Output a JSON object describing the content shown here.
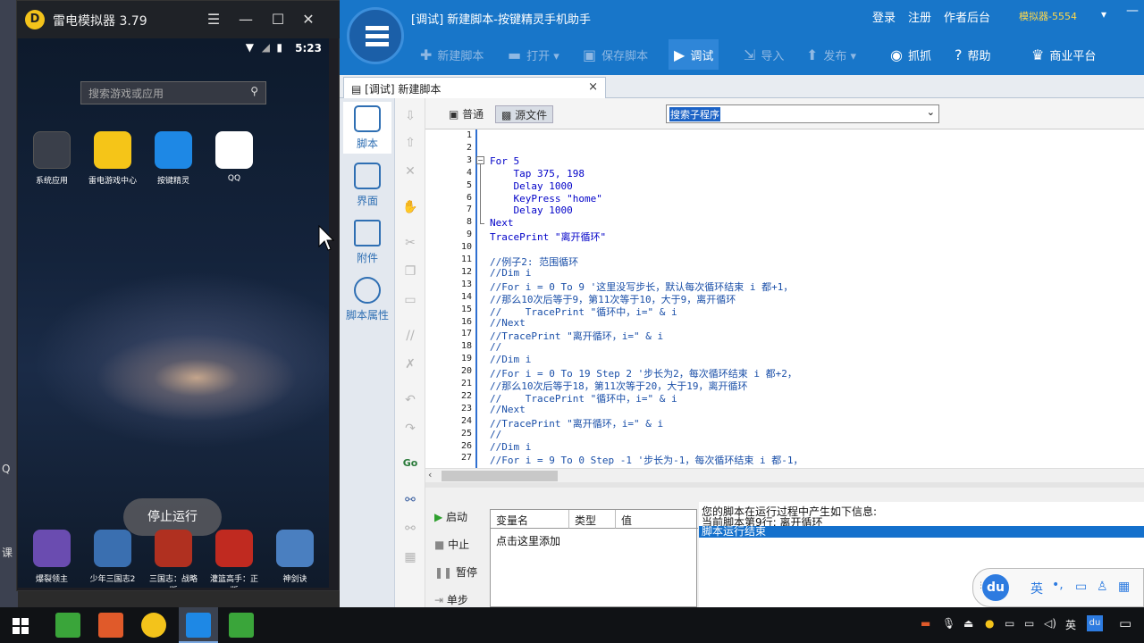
{
  "emulator": {
    "title": "雷电模拟器 3.79",
    "logo_letter": "D",
    "clock": "5:23",
    "search_placeholder": "搜索游戏或应用",
    "apps_top": [
      {
        "label": "系统应用",
        "color": "#3a3f4a"
      },
      {
        "label": "雷电游戏中心",
        "color": "#f5c518"
      },
      {
        "label": "按键精灵",
        "color": "#1e88e5"
      },
      {
        "label": "QQ",
        "color": "#ffffff"
      }
    ],
    "apps_bottom": [
      {
        "label": "爆裂领主",
        "color": "#6a4cb0"
      },
      {
        "label": "少年三国志2",
        "color": "#3a6fb0"
      },
      {
        "label": "三国志：战略版",
        "color": "#b03020"
      },
      {
        "label": "灌篮高手：正版",
        "color": "#c02a20"
      },
      {
        "label": "神剑诀",
        "color": "#4a7fc0"
      }
    ],
    "stop_button": "停止运行",
    "controls": {
      "menu": "☰",
      "minimize": "—",
      "maximize": "☐",
      "close": "✕"
    }
  },
  "desktop_left": {
    "chars": [
      "Q",
      "课"
    ]
  },
  "tool": {
    "window_title": "[调试] 新建脚本-按键精灵手机助手",
    "links": [
      "登录",
      "注册",
      "作者后台"
    ],
    "sim_badge": "模拟器-5554",
    "toolbar": [
      {
        "icon": "plus-icon",
        "glyph": "✚",
        "label": "新建脚本",
        "dim": true
      },
      {
        "icon": "folder-icon",
        "glyph": "▬",
        "label": "打开 ▾",
        "dim": true
      },
      {
        "icon": "save-icon",
        "glyph": "▣",
        "label": "保存脚本",
        "dim": true
      },
      {
        "icon": "debug-icon",
        "glyph": "▶",
        "label": "调试",
        "dim": false
      },
      {
        "icon": "import-icon",
        "glyph": "⇲",
        "label": "导入",
        "dim": true
      },
      {
        "icon": "publish-icon",
        "glyph": "⬆",
        "label": "发布 ▾",
        "dim": true
      },
      {
        "icon": "camera-icon",
        "glyph": "◉",
        "label": "抓抓",
        "dim": false
      },
      {
        "icon": "help-icon",
        "glyph": "?",
        "label": "帮助",
        "dim": false
      },
      {
        "icon": "shop-icon",
        "glyph": "♛",
        "label": "商业平台",
        "dim": false
      }
    ],
    "tab_label": "[调试] 新建脚本",
    "tab_close": "×",
    "vnav": [
      {
        "label": "脚本",
        "icon": "script-icon"
      },
      {
        "label": "界面",
        "icon": "ui-icon"
      },
      {
        "label": "附件",
        "icon": "attachment-icon"
      },
      {
        "label": "脚本属性",
        "icon": "info-icon"
      }
    ],
    "modes": [
      "普通",
      "源文件"
    ],
    "sub_search": "搜索子程序",
    "code_lines": [
      "",
      "",
      "For 5",
      "    Tap 375, 198",
      "    Delay 1000",
      "    KeyPress \"home\"",
      "    Delay 1000",
      "Next",
      "TracePrint \"离开循环\"",
      "",
      "//例子2: 范围循环",
      "//Dim i",
      "//For i = 0 To 9 '这里没写步长，默认每次循环结束 i 都+1，",
      "//那么10次后等于9，第11次等于10，大于9，离开循环",
      "//    TracePrint \"循环中，i=\" & i",
      "//Next",
      "//TracePrint \"离开循环，i=\" & i",
      "//",
      "//Dim i",
      "//For i = 0 To 19 Step 2 '步长为2，每次循环结束 i 都+2，",
      "//那么10次后等于18，第11次等于20，大于19，离开循环",
      "//    TracePrint \"循环中，i=\" & i",
      "//Next",
      "//TracePrint \"离开循环，i=\" & i",
      "//",
      "//Dim i",
      "//For i = 9 To 0 Step -1 '步长为-1，每次循环结束 i 都-1，"
    ],
    "controls": [
      "启动",
      "中止",
      "暂停",
      "单步"
    ],
    "var_headers": [
      "变量名",
      "类型",
      "值"
    ],
    "add_var": "点击这里添加",
    "output": [
      "您的脚本在运行过程中产生如下信息:",
      "当前脚本第9行: 离开循环",
      "脚本运行结束"
    ]
  },
  "ime": {
    "logo": "du",
    "items": [
      "英",
      "•,",
      "▭",
      "♙",
      "▦"
    ]
  },
  "taskbar": {
    "apps": [
      {
        "name": "windows-start",
        "color": "#ffffff"
      },
      {
        "name": "camtasia-green",
        "color": "#3aa53a"
      },
      {
        "name": "recorder-orange",
        "color": "#e05a2a"
      },
      {
        "name": "ldplayer",
        "color": "#f3c31b"
      },
      {
        "name": "anjian",
        "color": "#1e88e5"
      },
      {
        "name": "camtasia-editor",
        "color": "#3aa53a"
      }
    ],
    "tray_lang": "英",
    "tray_du": "du"
  }
}
